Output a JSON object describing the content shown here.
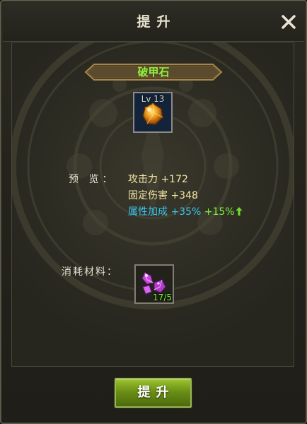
{
  "window": {
    "title": "提升",
    "close_icon": "close-icon"
  },
  "item": {
    "name": "破甲石",
    "level": "Lv 13",
    "icon": "orange-gem-icon"
  },
  "preview": {
    "label": "预 览：",
    "stats": {
      "attack": "攻击力 +172",
      "fixed_damage": "固定伤害 +348",
      "attribute_bonus": "属性加成 +35%",
      "attribute_bonus_extra": "+15%",
      "attribute_bonus_arrow": "up-arrow-icon"
    }
  },
  "materials": {
    "label": "消耗材料：",
    "item_icon": "purple-crystal-icon",
    "count": "17/5"
  },
  "actions": {
    "upgrade_label": "提升"
  },
  "colors": {
    "item_name": "#8ef03c",
    "stat_text": "#f2e6a2",
    "attribute_text": "#39c6ee",
    "bonus_green": "#7df33a",
    "button_green": "#6a8f16"
  }
}
